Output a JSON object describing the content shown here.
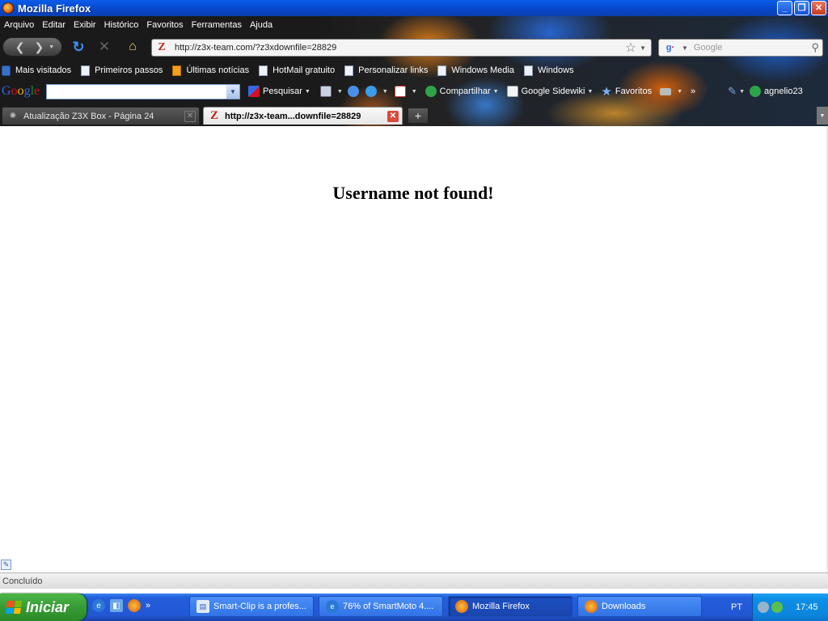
{
  "window": {
    "title": "Mozilla Firefox"
  },
  "menubar": {
    "items": [
      "Arquivo",
      "Editar",
      "Exibir",
      "Histórico",
      "Favoritos",
      "Ferramentas",
      "Ajuda"
    ]
  },
  "navbar": {
    "url": "http://z3x-team.com/?z3xdownfile=28829",
    "search_placeholder": "Google"
  },
  "bookmarks": {
    "items": [
      "Mais visitados",
      "Primeiros passos",
      "Últimas notícias",
      "HotMail gratuito",
      "Personalizar links",
      "Windows Media",
      "Windows"
    ]
  },
  "google_toolbar": {
    "logo": "Google",
    "search_label": "Pesquisar",
    "share_label": "Compartilhar",
    "sidewiki_label": "Google Sidewiki",
    "favorites_label": "Favoritos",
    "more_label": "»",
    "user": "agnelio23"
  },
  "tabs": {
    "inactive": {
      "label": "Atualização Z3X Box - Página 24"
    },
    "active": {
      "label": "http://z3x-team...downfile=28829"
    },
    "new_tab": "+"
  },
  "content": {
    "message": "Username not found!"
  },
  "statusbar": {
    "text": "Concluído"
  },
  "taskbar": {
    "start_label": "Iniciar",
    "quicklaunch_more": "»",
    "tasks": [
      {
        "label": "Smart-Clip is a profes..."
      },
      {
        "label": "76% of SmartMoto 4...."
      },
      {
        "label": "Mozilla Firefox"
      },
      {
        "label": "Downloads"
      }
    ],
    "language": "PT",
    "clock": "17:45"
  },
  "colors": {
    "xp_blue": "#245edb",
    "start_green": "#379c34",
    "z3x_red": "#c2261b"
  }
}
